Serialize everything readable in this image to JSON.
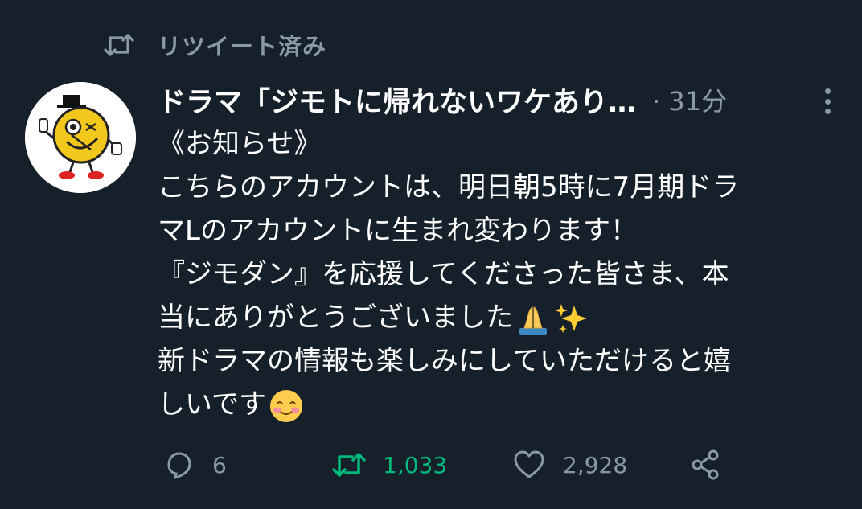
{
  "retweet_label": "リツイート済み",
  "tweet": {
    "author_name": "ドラマ「ジモトに帰れないワケあり…",
    "separator": "·",
    "time_ago": "31分",
    "body_lines": [
      "《お知らせ》",
      "こちらのアカウントは、明日朝5時に7月期ドラ",
      "マLのアカウントに生まれ変わります！",
      "『ジモダン』を応援してくださった皆さま、本",
      "当にありがとうございました",
      "新ドラマの情報も楽しみにしていただけると嬉",
      "しいです"
    ],
    "emoji": {
      "line5": [
        "folded-hands-emoji",
        "sparkles-emoji"
      ],
      "line7": [
        "smiling-face-emoji"
      ]
    }
  },
  "actions": {
    "reply_count": "6",
    "retweet_count": "1,033",
    "like_count": "2,928"
  },
  "colors": {
    "background": "#16202b",
    "text": "#ffffff",
    "muted": "#8b98a5",
    "retweet_active": "#00ba7c"
  },
  "icons": [
    "retweet-icon",
    "more-icon",
    "reply-icon",
    "retweet-icon",
    "like-icon",
    "share-icon"
  ]
}
